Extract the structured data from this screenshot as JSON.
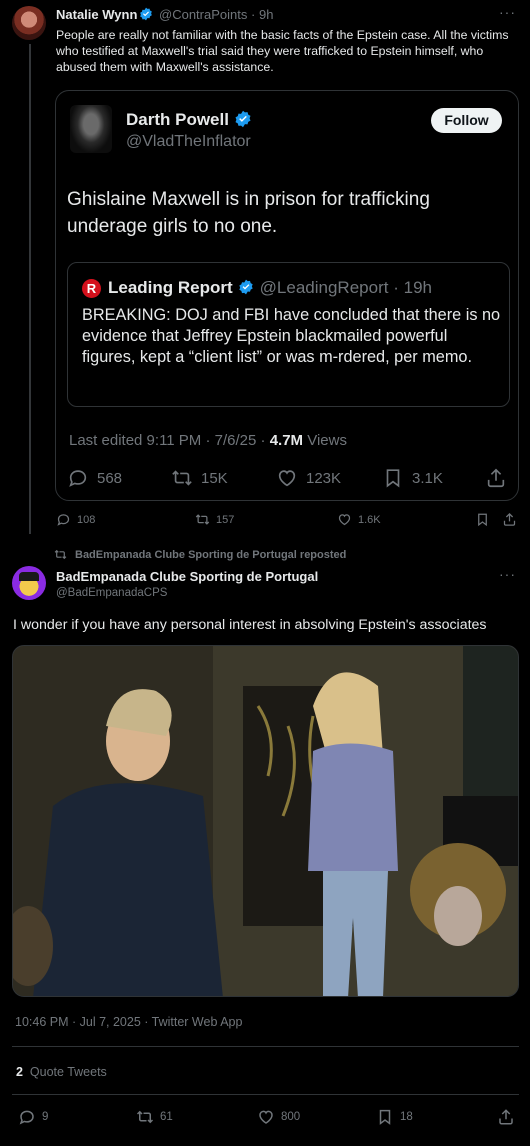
{
  "tweet1": {
    "name": "Natalie Wynn",
    "handle": "@ContraPoints",
    "separator": "·",
    "time": "9h",
    "text": "People are really not familiar with the basic facts of the Epstein case. All the victims who testified at Maxwell's trial said they were trafficked to Epstein himself, who abused them with Maxwell's assistance.",
    "more": "···",
    "actions": {
      "replies": "108",
      "reposts": "157",
      "likes": "1.6K"
    }
  },
  "embedded": {
    "name": "Darth Powell",
    "handle": "@VladTheInflator",
    "follow_label": "Follow",
    "text": "Ghislaine Maxwell is in prison for trafficking underage girls to no one.",
    "quoted": {
      "logo": "R",
      "name": "Leading Report",
      "handle": "@LeadingReport",
      "separator": "·",
      "time": "19h",
      "text": "BREAKING: DOJ and FBI have concluded that there is no evidence that Jeffrey Epstein blackmailed powerful figures, kept a “client list” or was m-rdered, per memo."
    },
    "last_edited": "Last edited 9:11 PM · 7/6/25 ·",
    "views_count": "4.7M",
    "views_label": "Views",
    "actions": {
      "replies": "568",
      "reposts": "15K",
      "likes": "123K",
      "bookmarks": "3.1K"
    }
  },
  "repost_header": "BadEmpanada Clube Sporting de Portugal reposted",
  "tweet2": {
    "name": "BadEmpanada Clube Sporting de Portugal",
    "handle": "@BadEmpanadaCPS",
    "more": "···",
    "text": "I wonder if you have any personal interest in absolving Epstein's associates",
    "timestamp": "10:46 PM · Jul 7, 2025 · Twitter Web App",
    "quote_count": "2",
    "quote_label": "Quote Tweets",
    "actions": {
      "replies": "9",
      "reposts": "61",
      "likes": "800",
      "bookmarks": "18"
    }
  },
  "colors": {
    "background": "#000000",
    "text": "#e7e9ea",
    "muted": "#71767b",
    "verified": "#1d9bf0",
    "border": "#2f3336",
    "leading_report_red": "#d4101c"
  }
}
